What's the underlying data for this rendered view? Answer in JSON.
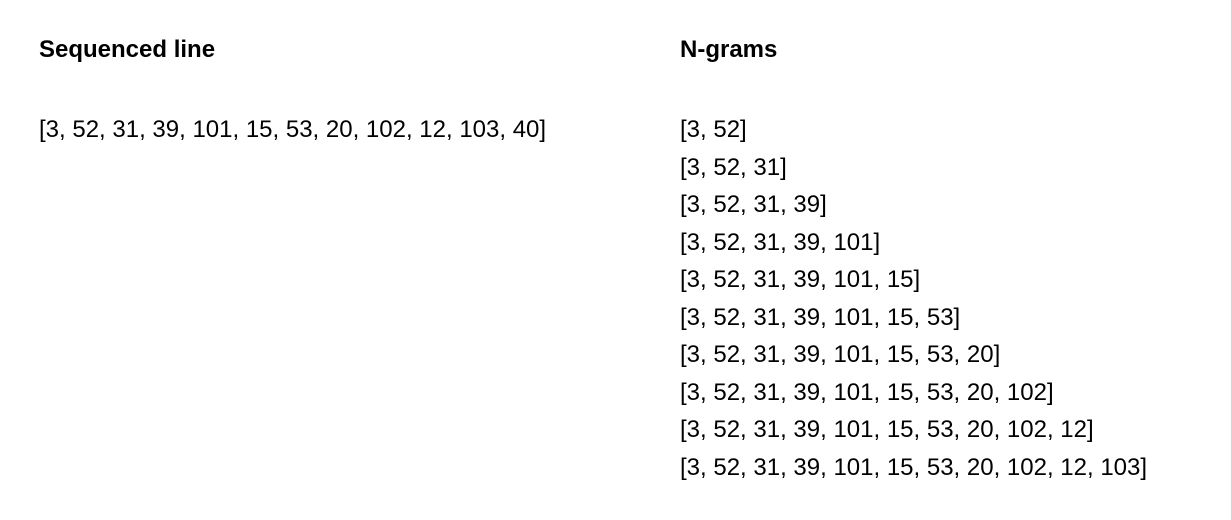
{
  "sequenced": {
    "heading": "Sequenced line",
    "line": "[3, 52, 31, 39, 101, 15, 53, 20, 102, 12, 103, 40]"
  },
  "ngrams": {
    "heading": "N-grams",
    "items": [
      "[3, 52]",
      "[3, 52, 31]",
      "[3, 52, 31, 39]",
      "[3, 52, 31, 39, 101]",
      "[3, 52, 31, 39, 101, 15]",
      "[3, 52, 31, 39, 101, 15, 53]",
      "[3, 52, 31, 39, 101, 15, 53, 20]",
      "[3, 52, 31, 39, 101, 15, 53, 20, 102]",
      "[3, 52, 31, 39, 101, 15, 53, 20, 102, 12]",
      "[3, 52, 31, 39, 101, 15, 53, 20, 102, 12, 103]"
    ]
  }
}
